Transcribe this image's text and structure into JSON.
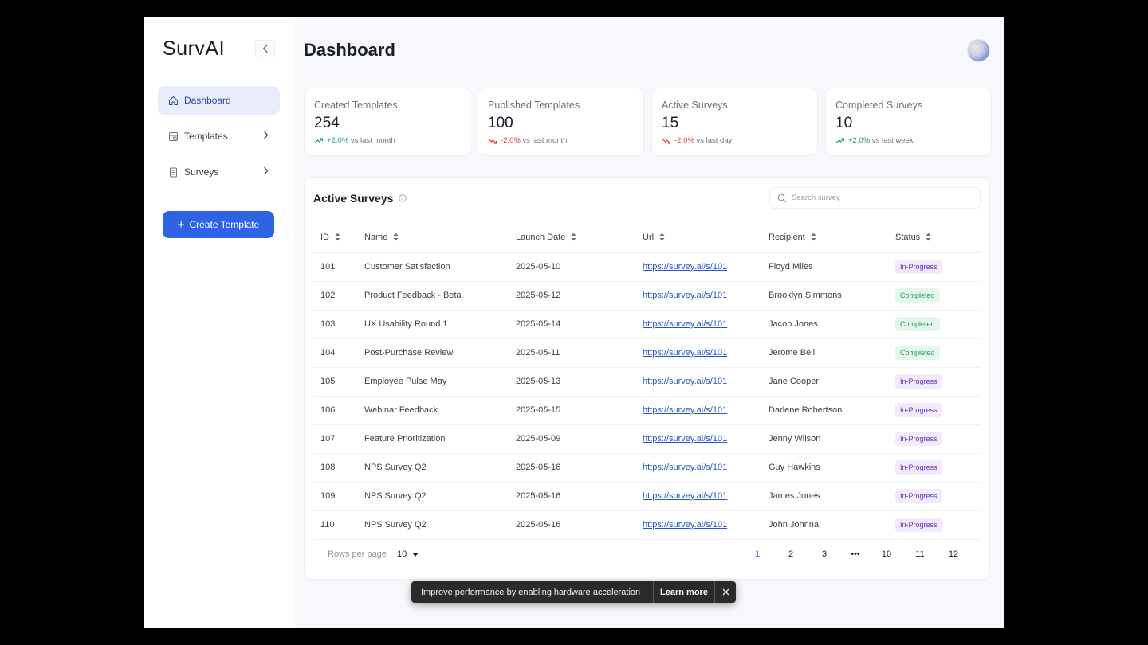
{
  "sidebar": {
    "brand": "SurvAI",
    "items": [
      {
        "label": "Dashboard"
      },
      {
        "label": "Templates"
      },
      {
        "label": "Surveys"
      }
    ],
    "create_label": "Create Template"
  },
  "header": {
    "title": "Dashboard"
  },
  "stats": [
    {
      "label": "Created Templates",
      "value": "254",
      "change": "+2.0%",
      "period": "vs last month",
      "direction": "up"
    },
    {
      "label": "Published Templates",
      "value": "100",
      "change": "-2.0%",
      "period": "vs last month",
      "direction": "down"
    },
    {
      "label": "Active Surveys",
      "value": "15",
      "change": "-2.0%",
      "period": "vs last day",
      "direction": "down"
    },
    {
      "label": "Completed Surveys",
      "value": "10",
      "change": "+2.0%",
      "period": "vs last week",
      "direction": "up"
    }
  ],
  "table": {
    "title": "Active Surveys",
    "search_placeholder": "Search survey",
    "columns": [
      "ID",
      "Name",
      "Launch Date",
      "Url",
      "Recipient",
      "Status"
    ],
    "rows": [
      {
        "id": "101",
        "name": "Customer Satisfaction",
        "date": "2025-05-10",
        "url": "https://survey.ai/s/101",
        "recipient": "Floyd Miles",
        "status": "In-Progress"
      },
      {
        "id": "102",
        "name": "Product Feedback - Beta",
        "date": "2025-05-12",
        "url": "https://survey.ai/s/101",
        "recipient": "Brooklyn Simmons",
        "status": "Completed"
      },
      {
        "id": "103",
        "name": "UX Usability Round 1",
        "date": "2025-05-14",
        "url": "https://survey.ai/s/101",
        "recipient": "Jacob Jones",
        "status": "Completed"
      },
      {
        "id": "104",
        "name": "Post-Purchase Review",
        "date": "2025-05-11",
        "url": "https://survey.ai/s/101",
        "recipient": "Jerome Bell",
        "status": "Completed"
      },
      {
        "id": "105",
        "name": "Employee Pulse May",
        "date": "2025-05-13",
        "url": "https://survey.ai/s/101",
        "recipient": "Jane Cooper",
        "status": "In-Progress"
      },
      {
        "id": "106",
        "name": "Webinar Feedback",
        "date": "2025-05-15",
        "url": "https://survey.ai/s/101",
        "recipient": "Darlene Robertson",
        "status": "In-Progress"
      },
      {
        "id": "107",
        "name": "Feature Prioritization",
        "date": "2025-05-09",
        "url": "https://survey.ai/s/101",
        "recipient": "Jenny Wilson",
        "status": "In-Progress"
      },
      {
        "id": "108",
        "name": "NPS Survey Q2",
        "date": "2025-05-16",
        "url": "https://survey.ai/s/101",
        "recipient": "Guy Hawkins",
        "status": "In-Progress"
      },
      {
        "id": "109",
        "name": "NPS Survey Q2",
        "date": "2025-05-16",
        "url": "https://survey.ai/s/101",
        "recipient": "James Jones",
        "status": "In-Progress"
      },
      {
        "id": "110",
        "name": "NPS Survey Q2",
        "date": "2025-05-16",
        "url": "https://survey.ai/s/101",
        "recipient": "John Johnna",
        "status": "In-Progress"
      }
    ]
  },
  "pagination": {
    "rows_label": "Rows per page",
    "rows_value": "10",
    "pages": [
      "1",
      "2",
      "3",
      "•••",
      "10",
      "11",
      "12"
    ],
    "current": "1"
  },
  "toast": {
    "message": "Improve performance by enabling hardware acceleration",
    "action": "Learn more"
  },
  "colors": {
    "accent": "#2f63e6",
    "up": "#1fa461",
    "down": "#e0383e",
    "in_progress": "#6a2fc2",
    "completed": "#1f9a55"
  }
}
